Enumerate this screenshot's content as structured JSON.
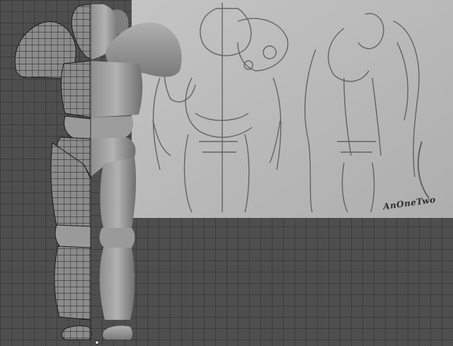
{
  "viewport": {
    "background_color": "#4e4e4e",
    "grid_color": "#3a3a3a",
    "sheet_color": "#b9b9b9"
  },
  "reference_image": {
    "signature_text": "AnOneTwo"
  },
  "model": {
    "mesh_color": "#8f8f8f",
    "wire_color": "#1a1a1a",
    "shaded_color": "#a8a8a8"
  }
}
